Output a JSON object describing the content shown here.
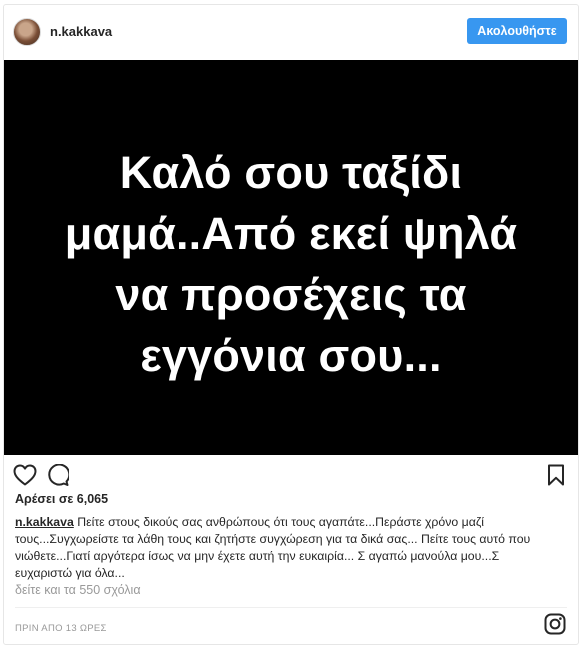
{
  "header": {
    "username": "n.kakkava",
    "follow_label": "Ακολουθήστε"
  },
  "post_image": {
    "lines": [
      "Καλό σου ταξίδι",
      "μαμά..Από εκεί ψηλά",
      "να προσέχεις τα",
      "εγγόνια σου..."
    ],
    "background_color": "#000000",
    "text_color": "#ffffff"
  },
  "actions": {
    "like_icon": "heart-icon",
    "comment_icon": "comment-icon",
    "save_icon": "bookmark-icon"
  },
  "likes_text": "Αρέσει σε 6,065",
  "caption": {
    "username": "n.kakkava",
    "text": "Πείτε στους δικούς σας ανθρώπους ότι τους αγαπάτε...Περάστε χρόνο μαζί τους...Συγχωρείστε τα λάθη τους και ζητήστε συγχώρεση για τα δικά σας... Πείτε τους αυτό που νιώθετε...Γιατί αργότερα ίσως να μην έχετε αυτή την ευκαιρία... Σ αγαπώ μανούλα μου...Σ ευχαριστώ για όλα..."
  },
  "view_comments": "δείτε και τα 550 σχόλια",
  "timestamp": "ΠΡΙΝ ΑΠΟ 13 ΩΡΕΣ",
  "footer_icon": "instagram-icon",
  "colors": {
    "accent": "#3897f0",
    "muted": "#999999",
    "text": "#262626",
    "border": "#e6e6e6"
  }
}
